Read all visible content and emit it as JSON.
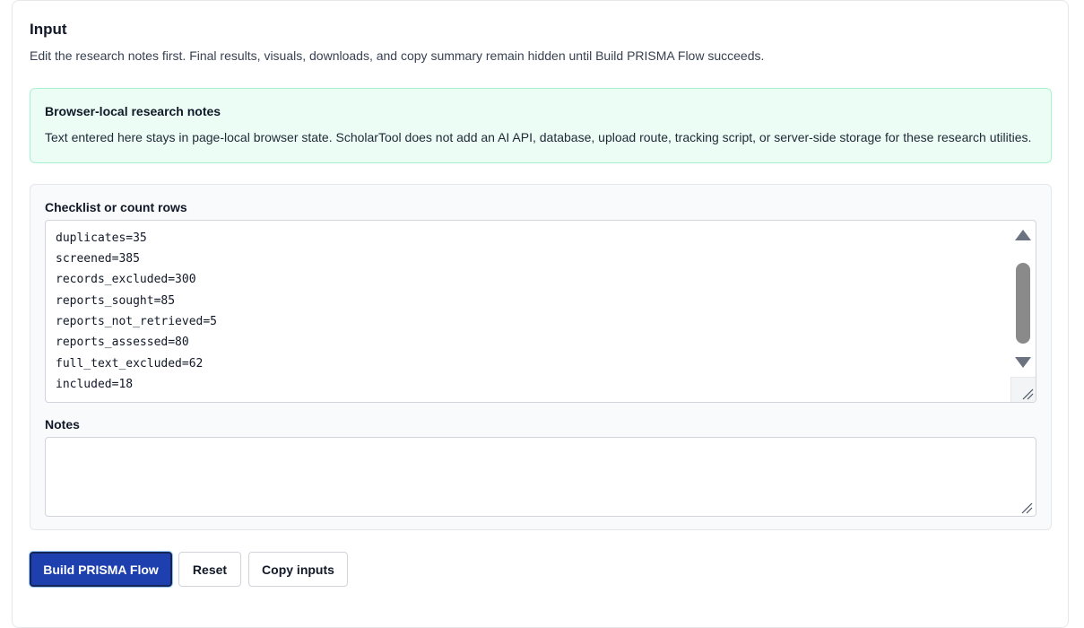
{
  "section": {
    "title": "Input",
    "description": "Edit the research notes first. Final results, visuals, downloads, and copy summary remain hidden until Build PRISMA Flow succeeds."
  },
  "notice": {
    "title": "Browser-local research notes",
    "text": "Text entered here stays in page-local browser state. ScholarTool does not add an AI API, database, upload route, tracking script, or server-side storage for these research utilities."
  },
  "checklist": {
    "label": "Checklist or count rows",
    "rows": [
      "duplicates=35",
      "screened=385",
      "records_excluded=300",
      "reports_sought=85",
      "reports_not_retrieved=5",
      "reports_assessed=80",
      "full_text_excluded=62",
      "included=18"
    ]
  },
  "notes": {
    "label": "Notes",
    "value": ""
  },
  "actions": {
    "build_label": "Build PRISMA Flow",
    "reset_label": "Reset",
    "copy_label": "Copy inputs"
  },
  "colors": {
    "primary": "#1e40af",
    "notice_bg": "#ecfdf5",
    "notice_border": "#a7f3d0"
  }
}
